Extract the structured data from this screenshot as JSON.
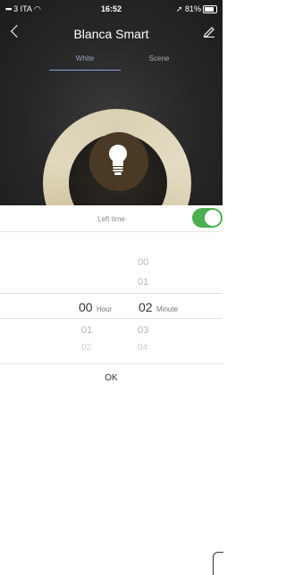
{
  "status": {
    "left": "3 ITA",
    "time": "16:52",
    "right": "81%"
  },
  "nav": {
    "title": "Blanca Smart"
  },
  "tabs": [
    {
      "label": "White"
    },
    {
      "label": "Scene"
    }
  ],
  "sheet": {
    "left_time_label": "Left time",
    "toggle_on": true,
    "hour_label": "Hour",
    "minute_label": "Minute",
    "hours": {
      "above": "",
      "selected": "00",
      "below1": "01",
      "below2": "02"
    },
    "minutes": {
      "above2": "00",
      "above1": "01",
      "selected": "02",
      "below1": "03",
      "below2": "04"
    },
    "ok_label": "OK"
  },
  "colors": {
    "accent": "#4caf50",
    "tab_active": "#8fa0d8"
  }
}
